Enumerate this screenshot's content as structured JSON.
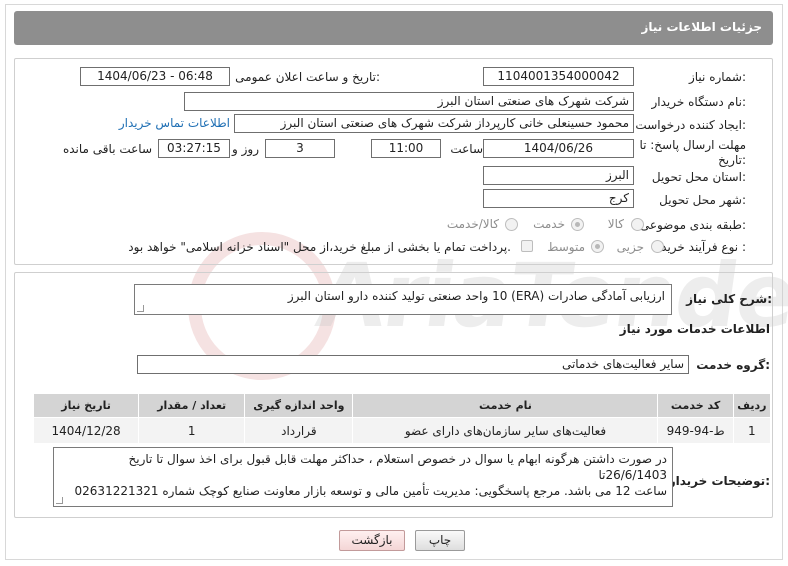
{
  "header": {
    "title": "جزئیات اطلاعات نیاز"
  },
  "form": {
    "need_number_label": "شماره نیاز:",
    "need_number": "1104001354000042",
    "announce_datetime_label": "تاریخ و ساعت اعلان عمومی:",
    "announce_datetime": "1404/06/23 - 06:48",
    "buyer_org_label": "نام دستگاه خریدار:",
    "buyer_org": "شرکت شهرک های صنعتی استان البرز",
    "requester_label": "ایجاد کننده درخواست:",
    "requester": "محمود حسینعلی خانی کارپرداز شرکت شهرک های صنعتی استان البرز",
    "buyer_contact_link": "اطلاعات تماس خریدار",
    "deadline_label": "مهلت ارسال پاسخ: تا تاریخ:",
    "deadline_date": "1404/06/26",
    "time_label": "ساعت",
    "deadline_time": "11:00",
    "days_count": "3",
    "days_label": "روز و",
    "remaining_time": "03:27:15",
    "remaining_label": "ساعت باقی مانده",
    "province_label": "استان محل تحویل:",
    "province": "البرز",
    "city_label": "شهر محل تحویل:",
    "city": "کرج",
    "category_label": "طبقه بندی موضوعی:",
    "category_options": [
      "کالا",
      "خدمت",
      "کالا/خدمت"
    ],
    "process_label": "نوع فرآیند خرید :",
    "process_options": [
      "جزیی",
      "متوسط"
    ],
    "treasury_note": "پرداخت تمام یا بخشی از مبلغ خرید،از محل \"اسناد خزانه اسلامی\" خواهد بود."
  },
  "details": {
    "summary_label": "شرح کلی نیاز:",
    "summary": "ارزیابی آمادگی صادرات (ERA) 10 واحد صنعتی تولید کننده دارو استان البرز",
    "services_title": "اطلاعات خدمات مورد نیاز",
    "service_group_label": "گروه خدمت:",
    "service_group": "سایر فعالیت‌های خدماتی",
    "table": {
      "headers": [
        "ردیف",
        "کد خدمت",
        "نام خدمت",
        "واحد اندازه گیری",
        "تعداد / مقدار",
        "تاریخ نیاز"
      ],
      "rows": [
        [
          "1",
          "ط-94-949",
          "فعالیت‌های سایر سازمان‌های دارای عضو",
          "قرارداد",
          "1",
          "1404/12/28"
        ]
      ]
    },
    "buyer_notes_label": "توضیحات خریدار:",
    "buyer_notes_line1": "در صورت داشتن هرگونه ابهام یا سوال در خصوص استعلام ، حداکثر مهلت قابل قبول برای اخذ سوال تا تاریخ  26/6/1403تا",
    "buyer_notes_line2": "ساعت 12 می باشد. مرجع پاسخگویی: مدیریت تأمین مالی و توسعه بازار معاونت صنایع کوچک شماره 02631221321"
  },
  "buttons": {
    "print": "چاپ",
    "back": "بازگشت"
  },
  "colors": {
    "header_bg": "#8e8e8e",
    "table_header_bg": "#d4d4d4",
    "link": "#1f6fb4"
  }
}
